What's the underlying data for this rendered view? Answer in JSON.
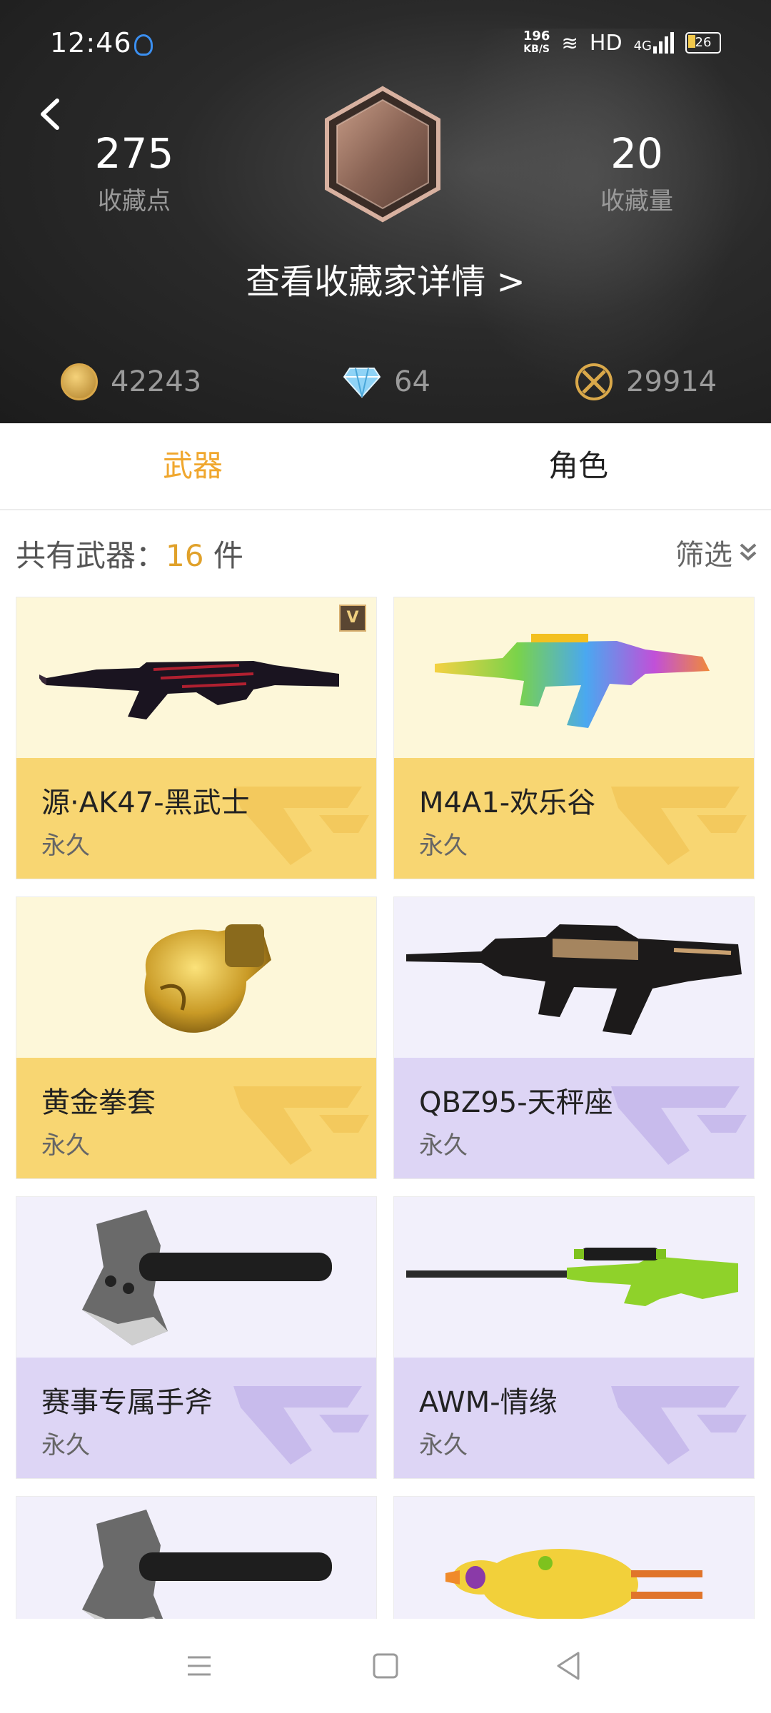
{
  "status_bar": {
    "time": "12:46",
    "speed_value": "196",
    "speed_unit": "KB/S",
    "hd": "HD",
    "network": "4G",
    "battery": "26"
  },
  "header": {
    "left_stat": {
      "value": "275",
      "label": "收藏点"
    },
    "right_stat": {
      "value": "20",
      "label": "收藏量"
    },
    "detail_link": "查看收藏家详情 >",
    "currencies": [
      {
        "icon": "coin-icon",
        "value": "42243"
      },
      {
        "icon": "diamond-icon",
        "value": "64"
      },
      {
        "icon": "crossed-swords-icon",
        "value": "29914"
      }
    ]
  },
  "tabs": [
    {
      "label": "武器",
      "active": true
    },
    {
      "label": "角色",
      "active": false
    }
  ],
  "summary": {
    "prefix": "共有武器：",
    "count": "16",
    "suffix": " 件",
    "filter_label": "筛选"
  },
  "items": [
    {
      "name": "源·AK47-黑武士",
      "term": "永久",
      "tier": "gold",
      "icon": "ak47-rifle-icon",
      "has_v_badge": true
    },
    {
      "name": "M4A1-欢乐谷",
      "term": "永久",
      "tier": "gold",
      "icon": "m4a1-rainbow-rifle-icon"
    },
    {
      "name": "黄金拳套",
      "term": "永久",
      "tier": "gold",
      "icon": "golden-boxing-glove-icon"
    },
    {
      "name": "QBZ95-天秤座",
      "term": "永久",
      "tier": "purple",
      "icon": "qbz95-rifle-icon"
    },
    {
      "name": "赛事专属手斧",
      "term": "永久",
      "tier": "purple",
      "icon": "hatchet-icon"
    },
    {
      "name": "AWM-情缘",
      "term": "永久",
      "tier": "purple",
      "icon": "awm-sniper-icon"
    },
    {
      "name": "",
      "term": "",
      "tier": "purple",
      "icon": "hatchet-icon"
    },
    {
      "name": "",
      "term": "",
      "tier": "purple",
      "icon": "rubber-chicken-icon"
    }
  ],
  "colors": {
    "accent": "#f0a72e",
    "gold_card": "#f8d672",
    "purple_card": "#ddd5f5"
  }
}
